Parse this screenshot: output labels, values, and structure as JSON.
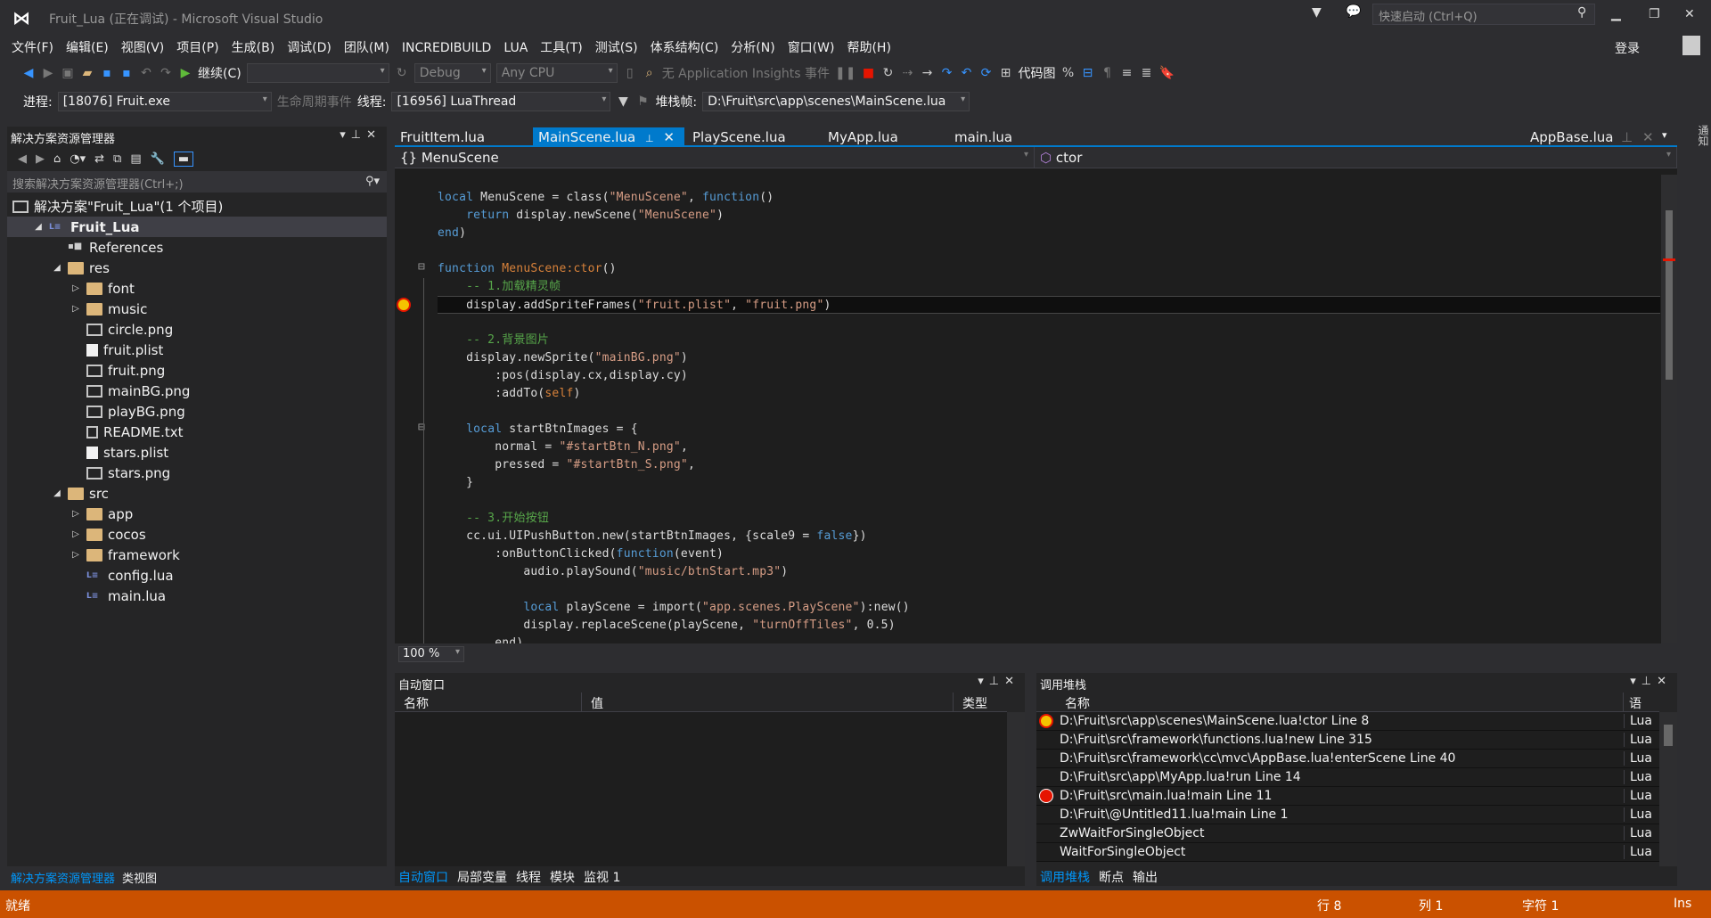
{
  "window": {
    "title": "Fruit_Lua (正在调试) - Microsoft Visual Studio",
    "quick_launch": "快速启动 (Ctrl+Q)",
    "signin": "登录"
  },
  "menu": [
    "文件(F)",
    "编辑(E)",
    "视图(V)",
    "项目(P)",
    "生成(B)",
    "调试(D)",
    "团队(M)",
    "INCREDIBUILD",
    "LUA",
    "工具(T)",
    "测试(S)",
    "体系结构(C)",
    "分析(N)",
    "窗口(W)",
    "帮助(H)"
  ],
  "toolbar": {
    "continue": "继续(C)",
    "config": "Debug",
    "platform": "Any CPU",
    "insights": "无 Application Insights 事件",
    "codemap": "代码图"
  },
  "debugbar": {
    "process_label": "进程:",
    "process": "[18076] Fruit.exe",
    "lifecycle": "生命周期事件",
    "thread_label": "线程:",
    "thread": "[16956] LuaThread",
    "stackframe_label": "堆栈帧:",
    "stackframe": "D:\\Fruit\\src\\app\\scenes\\MainScene.lua"
  },
  "solution_explorer": {
    "title": "解决方案资源管理器",
    "search_placeholder": "搜索解决方案资源管理器(Ctrl+;)",
    "items": [
      {
        "label": "解决方案\"Fruit_Lua\"(1 个项目)",
        "level": -1,
        "icon": "solution-icon",
        "expander": ""
      },
      {
        "label": "Fruit_Lua",
        "level": 0,
        "icon": "lua-project-icon",
        "expander": "expanded",
        "selected": true
      },
      {
        "label": "References",
        "level": 1,
        "icon": "references-icon",
        "expander": ""
      },
      {
        "label": "res",
        "level": 1,
        "icon": "folder-open-icon",
        "expander": "expanded"
      },
      {
        "label": "font",
        "level": 2,
        "icon": "folder-icon",
        "expander": "collapsed"
      },
      {
        "label": "music",
        "level": 2,
        "icon": "folder-icon",
        "expander": "collapsed"
      },
      {
        "label": "circle.png",
        "level": 2,
        "icon": "image-file-icon",
        "expander": ""
      },
      {
        "label": "fruit.plist",
        "level": 2,
        "icon": "file-icon",
        "expander": ""
      },
      {
        "label": "fruit.png",
        "level": 2,
        "icon": "image-file-icon",
        "expander": ""
      },
      {
        "label": "mainBG.png",
        "level": 2,
        "icon": "image-file-icon",
        "expander": ""
      },
      {
        "label": "playBG.png",
        "level": 2,
        "icon": "image-file-icon",
        "expander": ""
      },
      {
        "label": "README.txt",
        "level": 2,
        "icon": "text-file-icon",
        "expander": ""
      },
      {
        "label": "stars.plist",
        "level": 2,
        "icon": "file-icon",
        "expander": ""
      },
      {
        "label": "stars.png",
        "level": 2,
        "icon": "image-file-icon",
        "expander": ""
      },
      {
        "label": "src",
        "level": 1,
        "icon": "folder-open-icon",
        "expander": "expanded"
      },
      {
        "label": "app",
        "level": 2,
        "icon": "folder-icon",
        "expander": "collapsed"
      },
      {
        "label": "cocos",
        "level": 2,
        "icon": "folder-icon",
        "expander": "collapsed"
      },
      {
        "label": "framework",
        "level": 2,
        "icon": "folder-icon",
        "expander": "collapsed"
      },
      {
        "label": "config.lua",
        "level": 2,
        "icon": "lua-file-icon",
        "expander": ""
      },
      {
        "label": "main.lua",
        "level": 2,
        "icon": "lua-file-icon",
        "expander": ""
      }
    ],
    "bottom_tabs": [
      "解决方案资源管理器",
      "类视图"
    ]
  },
  "editor": {
    "tabs": [
      {
        "label": "FruitItem.lua"
      },
      {
        "label": "MainScene.lua",
        "active": true
      },
      {
        "label": "PlayScene.lua"
      },
      {
        "label": "MyApp.lua"
      },
      {
        "label": "main.lua"
      }
    ],
    "overflow_tab": "AppBase.lua",
    "nav_scope": "{} MenuScene",
    "nav_member": "ctor",
    "zoom": "100 %",
    "current_line_index": 6,
    "code": [
      [
        [
          "kw",
          "local"
        ],
        [
          "t",
          " MenuScene = class("
        ],
        [
          "str",
          "\"MenuScene\""
        ],
        [
          "t",
          ", "
        ],
        [
          "kw",
          "function"
        ],
        [
          "t",
          "()"
        ]
      ],
      [
        [
          "t",
          "    "
        ],
        [
          "kw",
          "return"
        ],
        [
          "t",
          " display.newScene("
        ],
        [
          "str",
          "\"MenuScene\""
        ],
        [
          "t",
          ")"
        ]
      ],
      [
        [
          "kw",
          "end"
        ],
        [
          "t",
          ")"
        ]
      ],
      [],
      [
        [
          "kw",
          "function"
        ],
        [
          "t",
          " "
        ],
        [
          "fn",
          "MenuScene:ctor"
        ],
        [
          "t",
          "()"
        ]
      ],
      [
        [
          "cm",
          "    -- 1.加载精灵帧"
        ]
      ],
      [
        [
          "t",
          "    display.addSpriteFrames("
        ],
        [
          "str",
          "\"fruit.plist\""
        ],
        [
          "t",
          ", "
        ],
        [
          "str",
          "\"fruit.png\""
        ],
        [
          "t",
          ")"
        ]
      ],
      [],
      [
        [
          "cm",
          "    -- 2.背景图片"
        ]
      ],
      [
        [
          "t",
          "    display.newSprite("
        ],
        [
          "str",
          "\"mainBG.png\""
        ],
        [
          "t",
          ")"
        ]
      ],
      [
        [
          "t",
          "        :pos(display.cx,display.cy)"
        ]
      ],
      [
        [
          "t",
          "        :addTo("
        ],
        [
          "fn",
          "self"
        ],
        [
          "t",
          ")"
        ]
      ],
      [],
      [
        [
          "t",
          "    "
        ],
        [
          "kw",
          "local"
        ],
        [
          "t",
          " startBtnImages = {"
        ]
      ],
      [
        [
          "t",
          "        normal = "
        ],
        [
          "str",
          "\"#startBtn_N.png\""
        ],
        [
          "t",
          ","
        ]
      ],
      [
        [
          "t",
          "        pressed = "
        ],
        [
          "str",
          "\"#startBtn_S.png\""
        ],
        [
          "t",
          ","
        ]
      ],
      [
        [
          "t",
          "    }"
        ]
      ],
      [],
      [
        [
          "cm",
          "    -- 3.开始按钮"
        ]
      ],
      [
        [
          "t",
          "    cc.ui.UIPushButton.new(startBtnImages, {scale9 = "
        ],
        [
          "kw",
          "false"
        ],
        [
          "t",
          "})"
        ]
      ],
      [
        [
          "t",
          "        :onButtonClicked("
        ],
        [
          "kw",
          "function"
        ],
        [
          "t",
          "(event)"
        ]
      ],
      [
        [
          "t",
          "            audio.playSound("
        ],
        [
          "str",
          "\"music/btnStart.mp3\""
        ],
        [
          "t",
          ")"
        ]
      ],
      [],
      [
        [
          "t",
          "            "
        ],
        [
          "kw",
          "local"
        ],
        [
          "t",
          " playScene = import("
        ],
        [
          "str",
          "\"app.scenes.PlayScene\""
        ],
        [
          "t",
          "):new()"
        ]
      ],
      [
        [
          "t",
          "            display.replaceScene(playScene, "
        ],
        [
          "str",
          "\"turnOffTiles\""
        ],
        [
          "t",
          ", 0.5)"
        ]
      ],
      [
        [
          "t",
          "        end)"
        ]
      ]
    ]
  },
  "autos": {
    "title": "自动窗口",
    "columns": [
      "名称",
      "值",
      "类型"
    ],
    "bottom_tabs": [
      "自动窗口",
      "局部变量",
      "线程",
      "模块",
      "监视 1"
    ]
  },
  "callstack": {
    "title": "调用堆栈",
    "columns": [
      "名称",
      "语言"
    ],
    "rows": [
      {
        "name": "D:\\Fruit\\src\\app\\scenes\\MainScene.lua!ctor Line 8",
        "lang": "Lua",
        "marker": "current"
      },
      {
        "name": "D:\\Fruit\\src\\framework\\functions.lua!new Line 315",
        "lang": "Lua",
        "marker": ""
      },
      {
        "name": "D:\\Fruit\\src\\framework\\cc\\mvc\\AppBase.lua!enterScene Line 40",
        "lang": "Lua",
        "marker": ""
      },
      {
        "name": "D:\\Fruit\\src\\app\\MyApp.lua!run Line 14",
        "lang": "Lua",
        "marker": ""
      },
      {
        "name": "D:\\Fruit\\src\\main.lua!main Line 11",
        "lang": "Lua",
        "marker": "breakpoint"
      },
      {
        "name": "D:\\Fruit\\@Untitled11.lua!main Line 1",
        "lang": "Lua",
        "marker": ""
      },
      {
        "name": "ZwWaitForSingleObject",
        "lang": "Lua",
        "marker": ""
      },
      {
        "name": "WaitForSingleObject",
        "lang": "Lua",
        "marker": ""
      }
    ],
    "bottom_tabs": [
      "调用堆栈",
      "断点",
      "输出"
    ]
  },
  "notifications_strip": "通知",
  "status": {
    "text": "就绪",
    "line": "行 8",
    "col": "列 1",
    "char": "字符 1",
    "mode": "Ins",
    "color": "#ca5100"
  }
}
